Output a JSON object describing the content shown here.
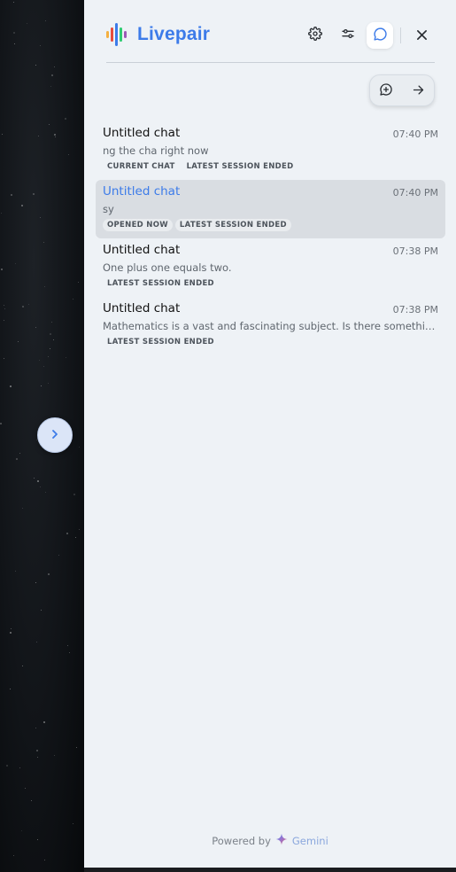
{
  "app": {
    "name": "Livepair",
    "logo_colors": [
      "#f5b041",
      "#e74c3c",
      "#3c7be9",
      "#2ecc71",
      "#9b59b6"
    ]
  },
  "header": {
    "buttons": [
      {
        "name": "settings-button",
        "icon": "gear-icon"
      },
      {
        "name": "preferences-button",
        "icon": "sliders-icon"
      },
      {
        "name": "chats-button",
        "icon": "chat-bubble-icon",
        "active": true
      },
      {
        "name": "close-button",
        "icon": "close-icon"
      }
    ]
  },
  "actions": {
    "new_chat_icon": "chat-plus-icon",
    "go_icon": "arrow-right-icon"
  },
  "chats": [
    {
      "title": "Untitled chat",
      "time": "07:40 PM",
      "preview": "ng the cha right now",
      "badges": [
        "CURRENT CHAT",
        "LATEST SESSION ENDED"
      ],
      "opened": false
    },
    {
      "title": "Untitled chat",
      "time": "07:40 PM",
      "preview": "sy",
      "badges": [
        "OPENED NOW",
        "LATEST SESSION ENDED"
      ],
      "opened": true
    },
    {
      "title": "Untitled chat",
      "time": "07:38 PM",
      "preview": "One plus one equals two.",
      "badges": [
        "LATEST SESSION ENDED"
      ],
      "opened": false
    },
    {
      "title": "Untitled chat",
      "time": "07:38 PM",
      "preview": "Mathematics is a vast and fascinating subject. Is there somethi…",
      "badges": [
        "LATEST SESSION ENDED"
      ],
      "opened": false
    }
  ],
  "footer": {
    "powered_by": "Powered by",
    "brand": "Gemini"
  },
  "colors": {
    "accent": "#3c7be9",
    "panel_bg": "#eef2f6",
    "selected_row_bg": "#d9dde2"
  }
}
